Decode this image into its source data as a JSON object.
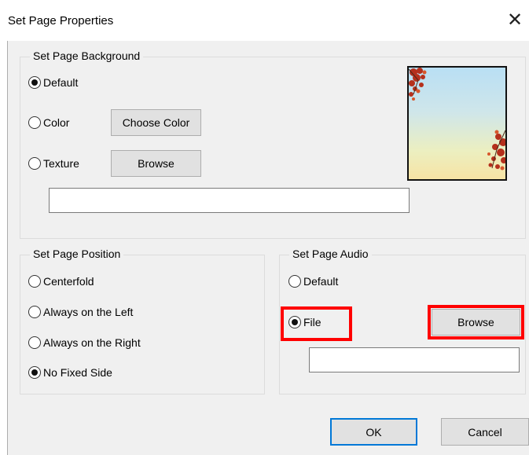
{
  "window": {
    "title": "Set Page Properties",
    "close_glyph": "✕"
  },
  "background_group": {
    "legend": "Set Page Background",
    "options": {
      "default": "Default",
      "color": "Color",
      "texture": "Texture"
    },
    "selected": "default",
    "choose_color_label": "Choose Color",
    "browse_label": "Browse",
    "texture_path": "",
    "preview_icon": "autumn-leaves-gradient-image"
  },
  "position_group": {
    "legend": "Set Page Position",
    "options": {
      "centerfold": "Centerfold",
      "left": "Always on the Left",
      "right": "Always on the Right",
      "none": "No Fixed Side"
    },
    "selected": "none"
  },
  "audio_group": {
    "legend": "Set Page Audio",
    "options": {
      "default": "Default",
      "file": "File"
    },
    "selected": "file",
    "browse_label": "Browse",
    "file_path": ""
  },
  "footer": {
    "ok_label": "OK",
    "cancel_label": "Cancel"
  },
  "colors": {
    "highlight": "#ff0000",
    "default_button_border": "#0078d7",
    "dialog_bg": "#f0f0f0"
  }
}
